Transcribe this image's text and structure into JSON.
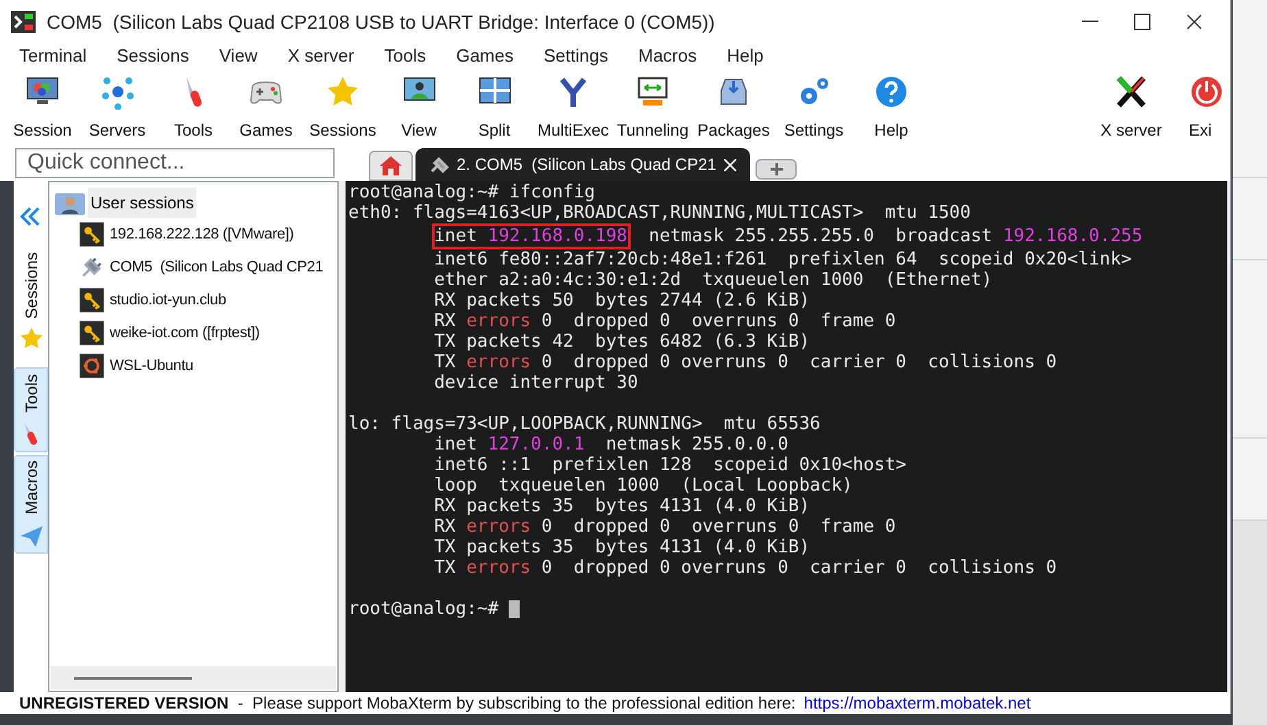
{
  "window": {
    "title": "COM5  (Silicon Labs Quad CP2108 USB to UART Bridge: Interface 0 (COM5))"
  },
  "menu": [
    "Terminal",
    "Sessions",
    "View",
    "X server",
    "Tools",
    "Games",
    "Settings",
    "Macros",
    "Help"
  ],
  "toolbar": [
    {
      "label": "Session",
      "kind": "session"
    },
    {
      "label": "Servers",
      "kind": "servers"
    },
    {
      "label": "Tools",
      "kind": "tools"
    },
    {
      "label": "Games",
      "kind": "games"
    },
    {
      "label": "Sessions",
      "kind": "star"
    },
    {
      "label": "View",
      "kind": "view"
    },
    {
      "label": "Split",
      "kind": "split"
    },
    {
      "label": "MultiExec",
      "kind": "fork"
    },
    {
      "label": "Tunneling",
      "kind": "tunnel"
    },
    {
      "label": "Packages",
      "kind": "packages"
    },
    {
      "label": "Settings",
      "kind": "gears"
    },
    {
      "label": "Help",
      "kind": "help"
    }
  ],
  "toolbar_right": [
    {
      "label": "X server",
      "kind": "x"
    },
    {
      "label": "Exi",
      "kind": "power"
    }
  ],
  "quick_connect": {
    "placeholder": "Quick connect..."
  },
  "side_tabs": [
    {
      "label": "Sessions",
      "kind": "star",
      "selected": true
    },
    {
      "label": "Tools",
      "kind": "tools",
      "selected": false
    },
    {
      "label": "Macros",
      "kind": "plane",
      "selected": false
    }
  ],
  "sessions": {
    "folder": "User sessions",
    "items": [
      {
        "label": "192.168.222.128 ([VMware])",
        "kind": "ssh"
      },
      {
        "label": "COM5  (Silicon Labs Quad CP21",
        "kind": "serial"
      },
      {
        "label": "studio.iot-yun.club",
        "kind": "ssh"
      },
      {
        "label": "weike-iot.com ([frptest])",
        "kind": "ssh"
      },
      {
        "label": "WSL-Ubuntu",
        "kind": "wsl"
      }
    ]
  },
  "tabs": [
    {
      "label": "2. COM5  (Silicon Labs Quad CP21",
      "selected": true
    }
  ],
  "terminal": {
    "lines": [
      {
        "indent": false,
        "gap_before": false,
        "segments": [
          {
            "text": "root@analog:~# ifconfig",
            "kind": "plain"
          }
        ]
      },
      {
        "indent": false,
        "gap_before": false,
        "segments": [
          {
            "text": "eth0: flags=4163<UP,BROADCAST,RUNNING,MULTICAST>  mtu 1500",
            "kind": "plain"
          }
        ]
      },
      {
        "indent": true,
        "gap_before": false,
        "segments": [
          {
            "text": "inet ",
            "kind": "plain",
            "boxed": true
          },
          {
            "text": "192.168.0.198",
            "kind": "address",
            "boxed": true
          },
          {
            "text": "  netmask 255.255.255.0  broadcast ",
            "kind": "plain",
            "boxed": false
          },
          {
            "text": "192.168.0.255",
            "kind": "address",
            "boxed": false
          }
        ]
      },
      {
        "indent": true,
        "gap_before": false,
        "segments": [
          {
            "text": "inet6 fe80::2af7:20cb:48e1:f261  prefixlen 64  scopeid 0x20<link>",
            "kind": "plain"
          }
        ]
      },
      {
        "indent": true,
        "gap_before": false,
        "segments": [
          {
            "text": "ether a2:a0:4c:30:e1:2d  txqueuelen 1000  (Ethernet)",
            "kind": "plain"
          }
        ]
      },
      {
        "indent": true,
        "gap_before": false,
        "segments": [
          {
            "text": "RX packets 50  bytes 2744 (2.6 KiB)",
            "kind": "plain"
          }
        ]
      },
      {
        "indent": true,
        "gap_before": false,
        "segments": [
          {
            "text": "RX ",
            "kind": "plain"
          },
          {
            "text": "errors",
            "kind": "error"
          },
          {
            "text": " 0  dropped 0  overruns 0  frame 0",
            "kind": "plain"
          }
        ]
      },
      {
        "indent": true,
        "gap_before": false,
        "segments": [
          {
            "text": "TX packets 42  bytes 6482 (6.3 KiB)",
            "kind": "plain"
          }
        ]
      },
      {
        "indent": true,
        "gap_before": false,
        "segments": [
          {
            "text": "TX ",
            "kind": "plain"
          },
          {
            "text": "errors",
            "kind": "error"
          },
          {
            "text": " 0  dropped 0 overruns 0  carrier 0  collisions 0",
            "kind": "plain"
          }
        ]
      },
      {
        "indent": true,
        "gap_before": false,
        "segments": [
          {
            "text": "device interrupt 30",
            "kind": "plain"
          }
        ]
      },
      {
        "indent": false,
        "gap_before": true,
        "segments": [
          {
            "text": "lo: flags=73<UP,LOOPBACK,RUNNING>  mtu 65536",
            "kind": "plain"
          }
        ]
      },
      {
        "indent": true,
        "gap_before": false,
        "segments": [
          {
            "text": "inet ",
            "kind": "plain"
          },
          {
            "text": "127.0.0.1",
            "kind": "address"
          },
          {
            "text": "  netmask 255.0.0.0",
            "kind": "plain"
          }
        ]
      },
      {
        "indent": true,
        "gap_before": false,
        "segments": [
          {
            "text": "inet6 ::1  prefixlen 128  scopeid 0x10<host>",
            "kind": "plain"
          }
        ]
      },
      {
        "indent": true,
        "gap_before": false,
        "segments": [
          {
            "text": "loop  txqueuelen 1000  (Local Loopback)",
            "kind": "plain"
          }
        ]
      },
      {
        "indent": true,
        "gap_before": false,
        "segments": [
          {
            "text": "RX packets 35  bytes 4131 (4.0 KiB)",
            "kind": "plain"
          }
        ]
      },
      {
        "indent": true,
        "gap_before": false,
        "segments": [
          {
            "text": "RX ",
            "kind": "plain"
          },
          {
            "text": "errors",
            "kind": "error"
          },
          {
            "text": " 0  dropped 0  overruns 0  frame 0",
            "kind": "plain"
          }
        ]
      },
      {
        "indent": true,
        "gap_before": false,
        "segments": [
          {
            "text": "TX packets 35  bytes 4131 (4.0 KiB)",
            "kind": "plain"
          }
        ]
      },
      {
        "indent": true,
        "gap_before": false,
        "segments": [
          {
            "text": "TX ",
            "kind": "plain"
          },
          {
            "text": "errors",
            "kind": "error"
          },
          {
            "text": " 0  dropped 0 overruns 0  carrier 0  collisions 0",
            "kind": "plain"
          }
        ]
      },
      {
        "indent": false,
        "gap_before": true,
        "segments": [
          {
            "text": "root@analog:~# ",
            "kind": "plain"
          }
        ]
      }
    ],
    "cursor": true
  },
  "status_bar": {
    "text": "**UNREGISTERED VERSION**  -  Please support MobaXterm by subscribing to the professional edition here:",
    "link": "https://mobaxterm.mobatek.net"
  }
}
